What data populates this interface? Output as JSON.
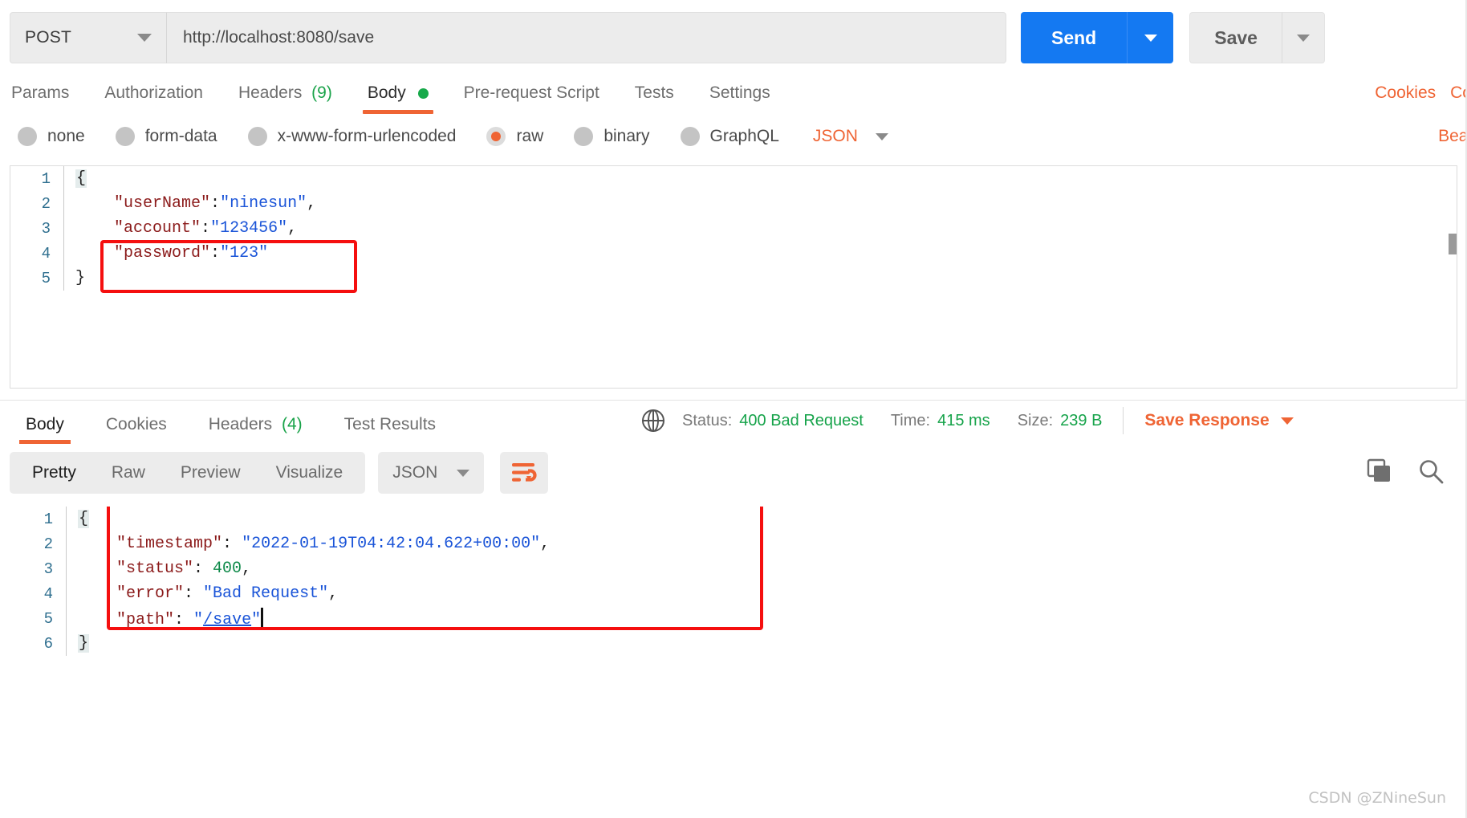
{
  "request": {
    "method": "POST",
    "url": "http://localhost:8080/save",
    "send_label": "Send",
    "save_label": "Save",
    "tabs": [
      {
        "label": "Params",
        "count": "",
        "active": false,
        "dot": false
      },
      {
        "label": "Authorization",
        "count": "",
        "active": false,
        "dot": false
      },
      {
        "label": "Headers",
        "count": "(9)",
        "active": false,
        "dot": false
      },
      {
        "label": "Body",
        "count": "",
        "active": true,
        "dot": true
      },
      {
        "label": "Pre-request Script",
        "count": "",
        "active": false,
        "dot": false
      },
      {
        "label": "Tests",
        "count": "",
        "active": false,
        "dot": false
      },
      {
        "label": "Settings",
        "count": "",
        "active": false,
        "dot": false
      }
    ],
    "tabs_right": [
      "Cookies",
      "Co"
    ],
    "body_types": [
      {
        "label": "none",
        "selected": false
      },
      {
        "label": "form-data",
        "selected": false
      },
      {
        "label": "x-www-form-urlencoded",
        "selected": false
      },
      {
        "label": "raw",
        "selected": true
      },
      {
        "label": "binary",
        "selected": false
      },
      {
        "label": "GraphQL",
        "selected": false
      }
    ],
    "raw_format": "JSON",
    "beautify_label": "Beautify",
    "code_lines": [
      {
        "no": "1",
        "tokens": [
          {
            "t": "{",
            "c": "brace"
          }
        ]
      },
      {
        "no": "2",
        "tokens": [
          {
            "t": "    ",
            "c": "p"
          },
          {
            "t": "\"userName\"",
            "c": "k"
          },
          {
            "t": ":",
            "c": "p"
          },
          {
            "t": "\"ninesun\"",
            "c": "s"
          },
          {
            "t": ",",
            "c": "p"
          }
        ]
      },
      {
        "no": "3",
        "tokens": [
          {
            "t": "    ",
            "c": "p"
          },
          {
            "t": "\"account\"",
            "c": "k"
          },
          {
            "t": ":",
            "c": "p"
          },
          {
            "t": "\"123456\"",
            "c": "s"
          },
          {
            "t": ",",
            "c": "p"
          }
        ]
      },
      {
        "no": "4",
        "tokens": [
          {
            "t": "    ",
            "c": "p"
          },
          {
            "t": "\"password\"",
            "c": "k"
          },
          {
            "t": ":",
            "c": "p"
          },
          {
            "t": "\"123\"",
            "c": "s"
          }
        ]
      },
      {
        "no": "5",
        "tokens": [
          {
            "t": "}",
            "c": "p"
          }
        ]
      }
    ]
  },
  "response": {
    "tabs": [
      {
        "label": "Body",
        "count": "",
        "active": true
      },
      {
        "label": "Cookies",
        "count": "",
        "active": false
      },
      {
        "label": "Headers",
        "count": "(4)",
        "active": false
      },
      {
        "label": "Test Results",
        "count": "",
        "active": false
      }
    ],
    "status_label": "Status:",
    "status_value": "400 Bad Request",
    "time_label": "Time:",
    "time_value": "415 ms",
    "size_label": "Size:",
    "size_value": "239 B",
    "save_response_label": "Save Response",
    "view_modes": [
      {
        "label": "Pretty",
        "active": true
      },
      {
        "label": "Raw",
        "active": false
      },
      {
        "label": "Preview",
        "active": false
      },
      {
        "label": "Visualize",
        "active": false
      }
    ],
    "format": "JSON",
    "code_lines": [
      {
        "no": "1",
        "tokens": [
          {
            "t": "{",
            "c": "brace"
          }
        ]
      },
      {
        "no": "2",
        "tokens": [
          {
            "t": "    ",
            "c": "p"
          },
          {
            "t": "\"timestamp\"",
            "c": "k"
          },
          {
            "t": ": ",
            "c": "p"
          },
          {
            "t": "\"2022-01-19T04:42:04.622+00:00\"",
            "c": "s"
          },
          {
            "t": ",",
            "c": "p"
          }
        ]
      },
      {
        "no": "3",
        "tokens": [
          {
            "t": "    ",
            "c": "p"
          },
          {
            "t": "\"status\"",
            "c": "k"
          },
          {
            "t": ": ",
            "c": "p"
          },
          {
            "t": "400",
            "c": "n"
          },
          {
            "t": ",",
            "c": "p"
          }
        ]
      },
      {
        "no": "4",
        "tokens": [
          {
            "t": "    ",
            "c": "p"
          },
          {
            "t": "\"error\"",
            "c": "k"
          },
          {
            "t": ": ",
            "c": "p"
          },
          {
            "t": "\"Bad Request\"",
            "c": "s"
          },
          {
            "t": ",",
            "c": "p"
          }
        ]
      },
      {
        "no": "5",
        "tokens": [
          {
            "t": "    ",
            "c": "p"
          },
          {
            "t": "\"path\"",
            "c": "k"
          },
          {
            "t": ": ",
            "c": "p"
          },
          {
            "t": "\"",
            "c": "s"
          },
          {
            "t": "/save",
            "c": "su"
          },
          {
            "t": "\"",
            "c": "s"
          }
        ],
        "cursor": true
      },
      {
        "no": "6",
        "tokens": [
          {
            "t": "}",
            "c": "brace"
          }
        ]
      }
    ]
  },
  "watermark": "CSDN @ZNineSun",
  "colors": {
    "accent_orange": "#ef6434",
    "send_blue": "#1479f2",
    "status_green": "#16a34a",
    "highlight_red": "#f50f0f"
  }
}
